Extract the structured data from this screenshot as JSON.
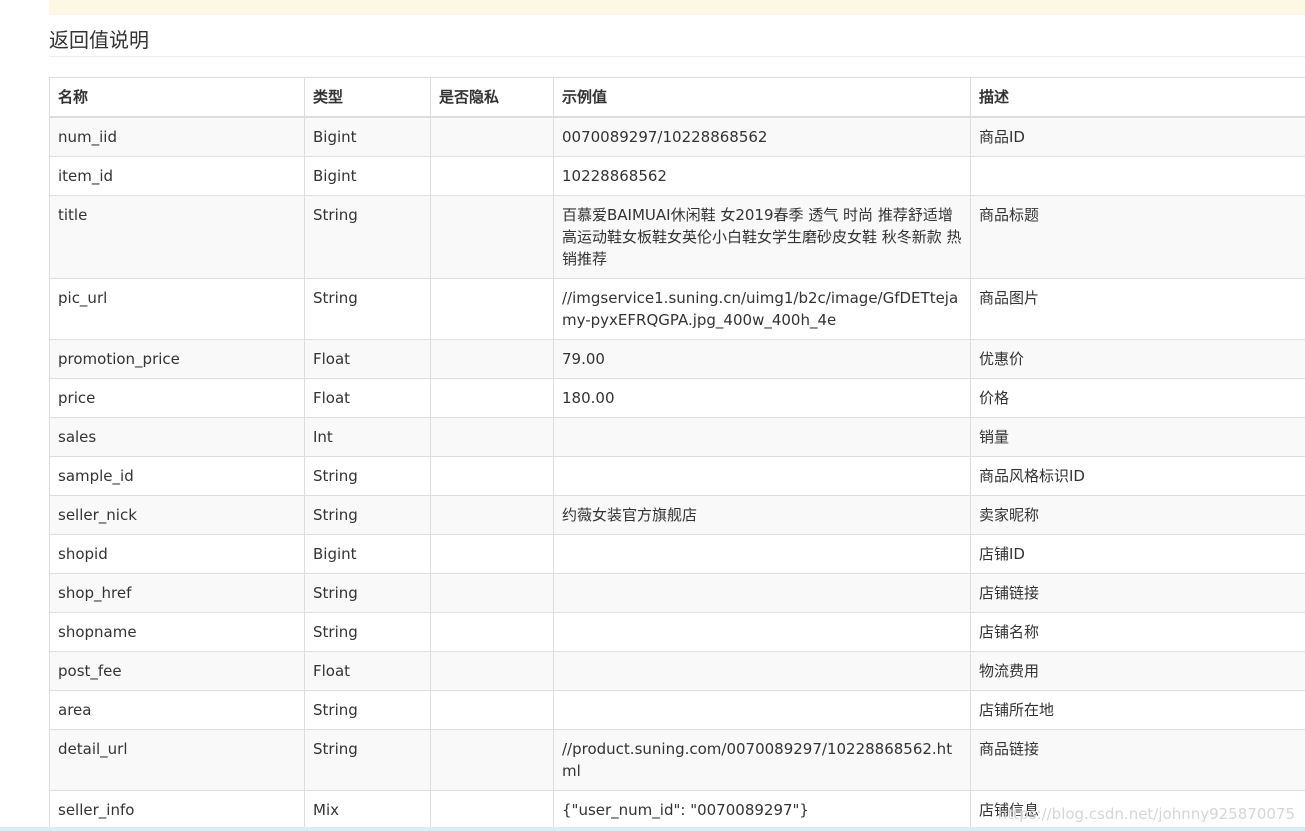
{
  "section_title": "返回值说明",
  "table": {
    "headers": [
      "名称",
      "类型",
      "是否隐私",
      "示例值",
      "描述"
    ],
    "rows": [
      [
        "num_iid",
        "Bigint",
        "",
        "0070089297/10228868562",
        "商品ID"
      ],
      [
        "item_id",
        "Bigint",
        "",
        "10228868562",
        ""
      ],
      [
        "title",
        "String",
        "",
        "百慕爱BAIMUAI休闲鞋 女2019春季 透气 时尚 推荐舒适增高运动鞋女板鞋女英伦小白鞋女学生磨砂皮女鞋 秋冬新款 热销推荐",
        "商品标题"
      ],
      [
        "pic_url",
        "String",
        "",
        "//imgservice1.suning.cn/uimg1/b2c/image/GfDETtejamy-pyxEFRQGPA.jpg_400w_400h_4e",
        "商品图片"
      ],
      [
        "promotion_price",
        "Float",
        "",
        "79.00",
        "优惠价"
      ],
      [
        "price",
        "Float",
        "",
        "180.00",
        "价格"
      ],
      [
        "sales",
        "Int",
        "",
        "",
        "销量"
      ],
      [
        "sample_id",
        "String",
        "",
        "",
        "商品风格标识ID"
      ],
      [
        "seller_nick",
        "String",
        "",
        "约薇女装官方旗舰店",
        "卖家昵称"
      ],
      [
        "shopid",
        "Bigint",
        "",
        "",
        "店铺ID"
      ],
      [
        "shop_href",
        "String",
        "",
        "",
        "店铺链接"
      ],
      [
        "shopname",
        "String",
        "",
        "",
        "店铺名称"
      ],
      [
        "post_fee",
        "Float",
        "",
        "",
        "物流费用"
      ],
      [
        "area",
        "String",
        "",
        "",
        "店铺所在地"
      ],
      [
        "detail_url",
        "String",
        "",
        "//product.suning.com/0070089297/10228868562.html",
        "商品链接"
      ],
      [
        "seller_info",
        "Mix",
        "",
        "{\"user_num_id\": \"0070089297\"}",
        "店铺信息"
      ]
    ]
  },
  "watermark": "https://blog.csdn.net/johnny925870075"
}
